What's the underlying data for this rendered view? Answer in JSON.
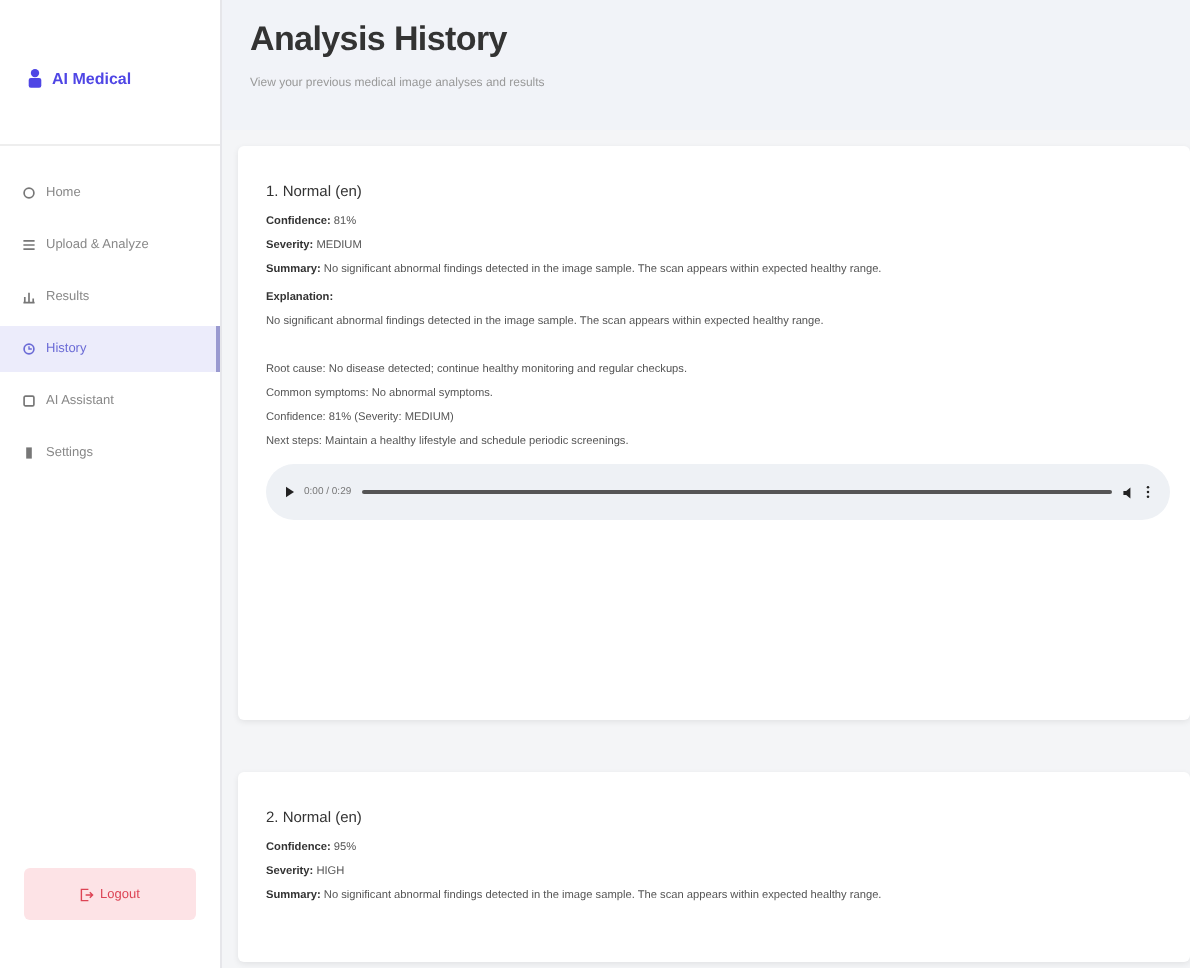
{
  "brand": {
    "name": "AI Medical"
  },
  "sidebar": {
    "items": [
      {
        "label": "Home",
        "selected": false
      },
      {
        "label": "Upload & Analyze",
        "selected": false
      },
      {
        "label": "Results",
        "selected": false
      },
      {
        "label": "History",
        "selected": true
      },
      {
        "label": "AI Assistant",
        "selected": false
      },
      {
        "label": "Settings",
        "selected": false
      }
    ],
    "logout": "Logout"
  },
  "header": {
    "title": "Analysis History",
    "subtitle": "View your previous medical image analyses and results"
  },
  "records": [
    {
      "title": "1. Normal (en)",
      "fields": [
        {
          "label": "Confidence:",
          "value": "81%"
        },
        {
          "label": "Severity:",
          "value": "MEDIUM"
        },
        {
          "label": "Summary:",
          "value": "No significant abnormal findings detected in the image sample. The scan appears within expected healthy range."
        }
      ],
      "explanation_label": "Explanation:",
      "explanation": "No significant abnormal findings detected in the image sample. The scan appears within expected healthy range.",
      "details": [
        "Root cause: No disease detected; continue healthy monitoring and regular checkups.",
        "Common symptoms: No abnormal symptoms.",
        "Confidence: 81% (Severity: MEDIUM)",
        "Next steps: Maintain a healthy lifestyle and schedule periodic screenings."
      ],
      "audio": {
        "time": "0:00 / 0:29"
      }
    },
    {
      "title": "2. Normal (en)",
      "fields": [
        {
          "label": "Confidence:",
          "value": "95%"
        },
        {
          "label": "Severity:",
          "value": "HIGH"
        },
        {
          "label": "Summary:",
          "value": "No significant abnormal findings detected in the image sample. The scan appears within expected healthy range."
        }
      ]
    }
  ]
}
